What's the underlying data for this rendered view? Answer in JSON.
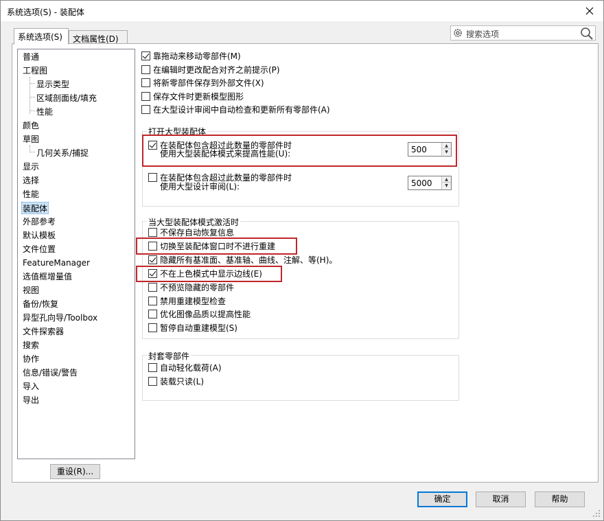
{
  "window": {
    "title": "系统选项(S) - 装配体",
    "close_glyph": "✕"
  },
  "tabs": [
    {
      "label": "系统选项(S)"
    },
    {
      "label": "文档属性(D)"
    }
  ],
  "search": {
    "placeholder": "搜索选项"
  },
  "tree": {
    "items": [
      {
        "label": "普通"
      },
      {
        "label": "工程图"
      },
      {
        "label": "显示类型"
      },
      {
        "label": "区域剖面线/填充"
      },
      {
        "label": "性能"
      },
      {
        "label": "颜色"
      },
      {
        "label": "草图"
      },
      {
        "label": "几何关系/捕捉"
      },
      {
        "label": "显示"
      },
      {
        "label": "选择"
      },
      {
        "label": "性能"
      },
      {
        "label": "装配体"
      },
      {
        "label": "外部参考"
      },
      {
        "label": "默认模板"
      },
      {
        "label": "文件位置"
      },
      {
        "label": "FeatureManager"
      },
      {
        "label": "选值框增量值"
      },
      {
        "label": "视图"
      },
      {
        "label": "备份/恢复"
      },
      {
        "label": "异型孔向导/Toolbox"
      },
      {
        "label": "文件探索器"
      },
      {
        "label": "搜索"
      },
      {
        "label": "协作"
      },
      {
        "label": "信息/错误/警告"
      },
      {
        "label": "导入"
      },
      {
        "label": "导出"
      }
    ]
  },
  "reset_button": "重设(R)...",
  "options": {
    "top": [
      {
        "label": "靠拖动来移动零部件(M)",
        "checked": true
      },
      {
        "label": "在编辑时更改配合对齐之前提示(P)",
        "checked": false
      },
      {
        "label": "将新零部件保存到外部文件(X)",
        "checked": false
      },
      {
        "label": "保存文件时更新模型图形",
        "checked": false
      },
      {
        "label": "在大型设计审阅中自动检查和更新所有零部件(A)",
        "checked": false
      }
    ],
    "large_assembly": {
      "title": "打开大型装配体",
      "opt1": {
        "line1": "在装配体包含超过此数量的零部件时",
        "line2": "使用大型装配体模式来提高性能(U):",
        "checked": true,
        "value": "500"
      },
      "opt2": {
        "line1": "在装配体包含超过此数量的零部件时",
        "line2": "使用大型设计审阅(L):",
        "checked": false,
        "value": "5000"
      }
    },
    "large_mode": {
      "title": "当大型装配体模式激活时",
      "items": [
        {
          "label": "不保存自动恢复信息",
          "checked": false
        },
        {
          "label": "切换至装配体窗口时不进行重建",
          "checked": false
        },
        {
          "label": "隐藏所有基准面、基准轴、曲线、注解、等(H)。",
          "checked": true
        },
        {
          "label": "不在上色模式中显示边线(E)",
          "checked": true
        },
        {
          "label": "不预览隐藏的零部件",
          "checked": false
        },
        {
          "label": "禁用重建模型检查",
          "checked": false
        },
        {
          "label": "优化图像品质以提高性能",
          "checked": false
        },
        {
          "label": "暂停自动重建模型(S)",
          "checked": false
        }
      ]
    },
    "envelope": {
      "title": "封套零部件",
      "items": [
        {
          "label": "自动轻化载荷(A)",
          "checked": false
        },
        {
          "label": "装载只读(L)",
          "checked": false
        }
      ]
    }
  },
  "footer": {
    "ok": "确定",
    "cancel": "取消",
    "help": "帮助"
  },
  "colors": {
    "highlight_box": "#c0262a",
    "selection": "#cce4f7",
    "default_border": "#0078d7"
  }
}
